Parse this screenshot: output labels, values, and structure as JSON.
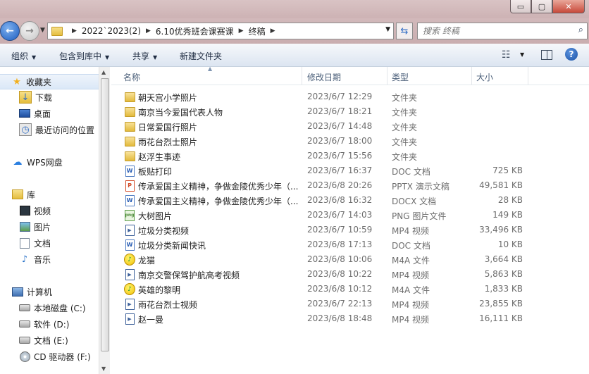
{
  "address": {
    "crumbs": [
      "2022`2023(2)",
      "6.10优秀班会课赛课",
      "终稿"
    ],
    "search_placeholder": "搜索 终稿"
  },
  "toolbar": {
    "organize": "组织",
    "include_in_library": "包含到库中",
    "share": "共享",
    "new_folder": "新建文件夹"
  },
  "window_controls": {
    "minimize": "▭",
    "maximize": "▢",
    "close": "✕"
  },
  "nav": {
    "favorites": {
      "label": "收藏夹",
      "items": [
        "下载",
        "桌面",
        "最近访问的位置"
      ]
    },
    "wps": {
      "label": "WPS网盘"
    },
    "libraries": {
      "label": "库",
      "items": [
        "视频",
        "图片",
        "文档",
        "音乐"
      ]
    },
    "computer": {
      "label": "计算机",
      "items": [
        "本地磁盘 (C:)",
        "软件 (D:)",
        "文档 (E:)",
        "CD 驱动器 (F:)"
      ]
    }
  },
  "columns": {
    "name": "名称",
    "date": "修改日期",
    "type": "类型",
    "size": "大小"
  },
  "files": [
    {
      "name": "朝天宫小学照片",
      "date": "2023/6/7 12:29",
      "type": "文件夹",
      "size": "",
      "icon": "folder-icon"
    },
    {
      "name": "南京当今爱国代表人物",
      "date": "2023/6/7 18:21",
      "type": "文件夹",
      "size": "",
      "icon": "folder-icon"
    },
    {
      "name": "日常爱国行照片",
      "date": "2023/6/7 14:48",
      "type": "文件夹",
      "size": "",
      "icon": "folder-icon"
    },
    {
      "name": "雨花台烈士照片",
      "date": "2023/6/7 18:00",
      "type": "文件夹",
      "size": "",
      "icon": "folder-icon"
    },
    {
      "name": "赵浮生事迹",
      "date": "2023/6/7 15:56",
      "type": "文件夹",
      "size": "",
      "icon": "folder-icon"
    },
    {
      "name": "板贴打印",
      "date": "2023/6/7 16:37",
      "type": "DOC 文档",
      "size": "725 KB",
      "icon": "doc-icon"
    },
    {
      "name": "传承爱国主义精神，争做金陵优秀少年（...",
      "date": "2023/6/8 20:26",
      "type": "PPTX 演示文稿",
      "size": "49,581 KB",
      "icon": "pptx-icon"
    },
    {
      "name": "传承爱国主义精神，争做金陵优秀少年（...",
      "date": "2023/6/8 16:32",
      "type": "DOCX 文档",
      "size": "28 KB",
      "icon": "doc-icon"
    },
    {
      "name": "大树图片",
      "date": "2023/6/7 14:03",
      "type": "PNG 图片文件",
      "size": "149 KB",
      "icon": "png-icon"
    },
    {
      "name": "垃圾分类视频",
      "date": "2023/6/7 10:59",
      "type": "MP4 视频",
      "size": "33,496 KB",
      "icon": "mp4-icon"
    },
    {
      "name": "垃圾分类新闻快讯",
      "date": "2023/6/8 17:13",
      "type": "DOC 文档",
      "size": "10 KB",
      "icon": "doc-icon"
    },
    {
      "name": "龙猫",
      "date": "2023/6/8 10:06",
      "type": "M4A 文件",
      "size": "3,664 KB",
      "icon": "m4a-icon"
    },
    {
      "name": "南京交警保驾护航高考视频",
      "date": "2023/6/8 10:22",
      "type": "MP4 视频",
      "size": "5,863 KB",
      "icon": "mp4-icon"
    },
    {
      "name": "英雄的黎明",
      "date": "2023/6/8 10:12",
      "type": "M4A 文件",
      "size": "1,833 KB",
      "icon": "m4a-icon"
    },
    {
      "name": "雨花台烈士视频",
      "date": "2023/6/7 22:13",
      "type": "MP4 视频",
      "size": "23,855 KB",
      "icon": "mp4-icon"
    },
    {
      "name": "赵一曼",
      "date": "2023/6/8 18:48",
      "type": "MP4 视频",
      "size": "16,111 KB",
      "icon": "mp4-icon"
    }
  ]
}
